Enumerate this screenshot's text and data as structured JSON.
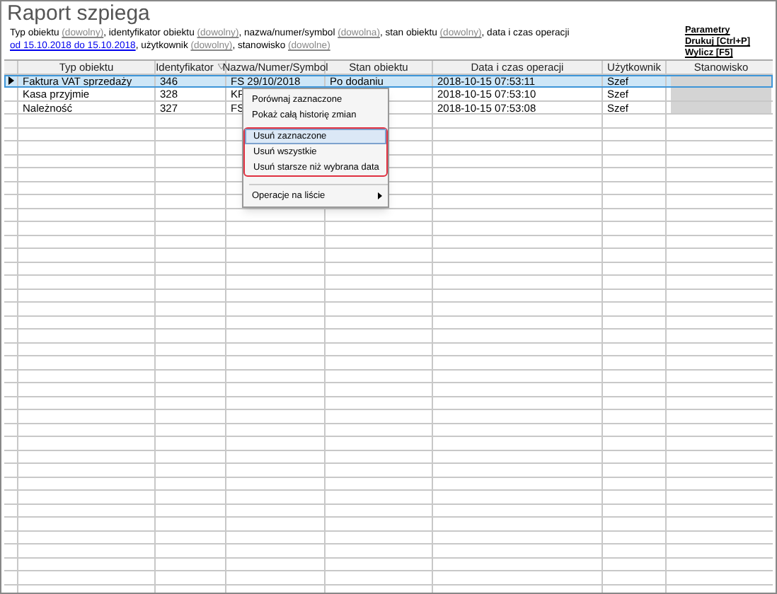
{
  "title": "Raport szpiega",
  "filter": [
    {
      "kind": "text",
      "text": "Typ obiektu "
    },
    {
      "kind": "value",
      "text": "(dowolny)"
    },
    {
      "kind": "text",
      "text": ", identyfikator obiektu "
    },
    {
      "kind": "value",
      "text": "(dowolny)"
    },
    {
      "kind": "text",
      "text": ", nazwa/numer/symbol "
    },
    {
      "kind": "value",
      "text": "(dowolna)"
    },
    {
      "kind": "text",
      "text": ", stan obiektu "
    },
    {
      "kind": "value",
      "text": "(dowolny)"
    },
    {
      "kind": "text",
      "text": ", data i czas operacji "
    },
    {
      "kind": "link",
      "text": "od 15.10.2018 do 15.10.2018"
    },
    {
      "kind": "text",
      "text": ", użytkownik "
    },
    {
      "kind": "value",
      "text": "(dowolny)"
    },
    {
      "kind": "text",
      "text": ", stanowisko "
    },
    {
      "kind": "value",
      "text": "(dowolne)"
    }
  ],
  "actions": [
    "Parametry",
    "Drukuj [Ctrl+P]",
    "Wylicz [F5]"
  ],
  "table": {
    "columns": [
      {
        "label": "Typ obiektu",
        "sorted": false
      },
      {
        "label": "Identyfikator",
        "sorted": true
      },
      {
        "label": "Nazwa/Numer/Symbol",
        "sorted": false
      },
      {
        "label": "Stan obiektu",
        "sorted": false
      },
      {
        "label": "Data i czas operacji",
        "sorted": false
      },
      {
        "label": "Użytkownik",
        "sorted": false
      },
      {
        "label": "Stanowisko",
        "sorted": false
      }
    ],
    "rows": [
      {
        "selected": true,
        "cells": [
          "Faktura VAT sprzedaży",
          "346",
          "FS 29/10/2018",
          "Po dodaniu",
          "2018-10-15 07:53:11",
          "Szef"
        ],
        "redacted": true
      },
      {
        "selected": false,
        "cells": [
          "Kasa przyjmie",
          "328",
          "KP",
          "",
          "2018-10-15 07:53:10",
          "Szef"
        ],
        "redacted": true
      },
      {
        "selected": false,
        "cells": [
          "Należność",
          "327",
          "FS",
          "",
          "2018-10-15 07:53:08",
          "Szef"
        ],
        "redacted": true
      }
    ]
  },
  "context_menu": {
    "items": [
      {
        "kind": "item",
        "label": "Porównaj zaznaczone",
        "highlighted": false,
        "marked": false
      },
      {
        "kind": "item",
        "label": "Pokaż całą historię zmian",
        "highlighted": false,
        "marked": false
      },
      {
        "kind": "item",
        "label": "Usuń zaznaczone",
        "highlighted": true,
        "marked": true
      },
      {
        "kind": "item",
        "label": "Usuń wszystkie",
        "highlighted": false,
        "marked": true
      },
      {
        "kind": "item",
        "label": "Usuń starsze niż wybrana data",
        "highlighted": false,
        "marked": true
      },
      {
        "kind": "separator"
      },
      {
        "kind": "submenu",
        "label": "Operacje na liście",
        "highlighted": false,
        "marked": false
      }
    ]
  }
}
